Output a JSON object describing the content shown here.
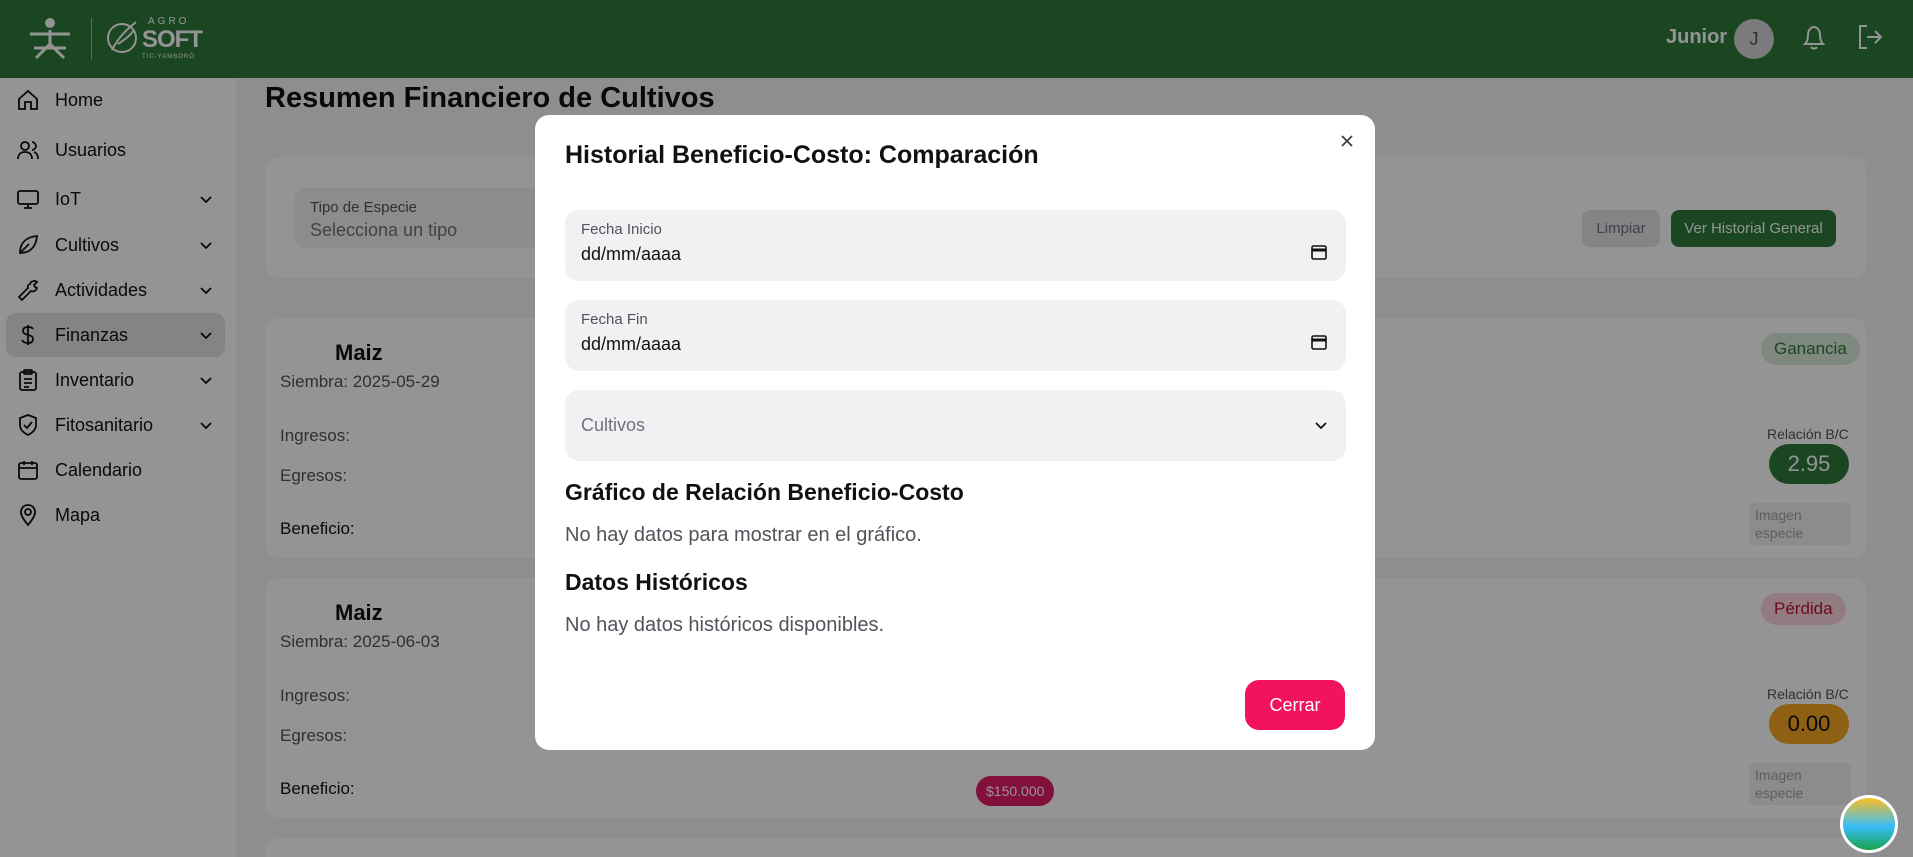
{
  "header": {
    "brand_sena": "SENA",
    "brand_agro": "AGRO",
    "brand_soft": "SOFT",
    "brand_sub": "TIC-YAMBORÓ",
    "user_name": "Junior",
    "avatar_initial": "J",
    "color": "#2d7a3a"
  },
  "sidebar": {
    "items": [
      {
        "label": "Home",
        "icon": "home-icon"
      },
      {
        "label": "Usuarios",
        "icon": "users-icon"
      },
      {
        "label": "IoT",
        "icon": "monitor-icon"
      },
      {
        "label": "Cultivos",
        "icon": "leaf-icon"
      },
      {
        "label": "Actividades",
        "icon": "wrench-icon"
      },
      {
        "label": "Finanzas",
        "icon": "dollar-icon"
      },
      {
        "label": "Inventario",
        "icon": "clipboard-icon"
      },
      {
        "label": "Fitosanitario",
        "icon": "shield-icon"
      },
      {
        "label": "Calendario",
        "icon": "calendar-icon"
      },
      {
        "label": "Mapa",
        "icon": "map-pin-icon"
      }
    ]
  },
  "main": {
    "title": "Resumen Financiero de Cultivos",
    "filter": {
      "species_label": "Tipo de Especie",
      "species_placeholder": "Selecciona un tipo",
      "clear_label": "Limpiar",
      "history_label": "Ver Historial General"
    },
    "cards": [
      {
        "name": "Maiz",
        "sowing": "Siembra: 2025-05-29",
        "income_label": "Ingresos:",
        "expense_label": "Egresos:",
        "benefit_label": "Beneficio:",
        "status": "Ganancia",
        "ratio_label": "Relación B/C",
        "ratio": "2.95",
        "image_placeholder": "Imagen especie"
      },
      {
        "name": "Maiz",
        "sowing": "Siembra: 2025-06-03",
        "income_label": "Ingresos:",
        "expense_label": "Egresos:",
        "benefit_label": "Beneficio:",
        "benefit_value": "$150.000",
        "status": "Pérdida",
        "ratio_label": "Relación B/C",
        "ratio": "0.00",
        "image_placeholder": "Imagen especie"
      }
    ]
  },
  "modal": {
    "title": "Historial Beneficio-Costo: Comparación",
    "start_label": "Fecha Inicio",
    "start_value": "dd/mm/aaaa",
    "end_label": "Fecha Fin",
    "end_value": "dd/mm/aaaa",
    "crops_label": "Cultivos",
    "chart_title": "Gráfico de Relación Beneficio-Costo",
    "chart_empty": "No hay datos para mostrar en el gráfico.",
    "history_title": "Datos Históricos",
    "history_empty": "No hay datos históricos disponibles.",
    "close_label": "Cerrar",
    "accent": "#f31260"
  }
}
